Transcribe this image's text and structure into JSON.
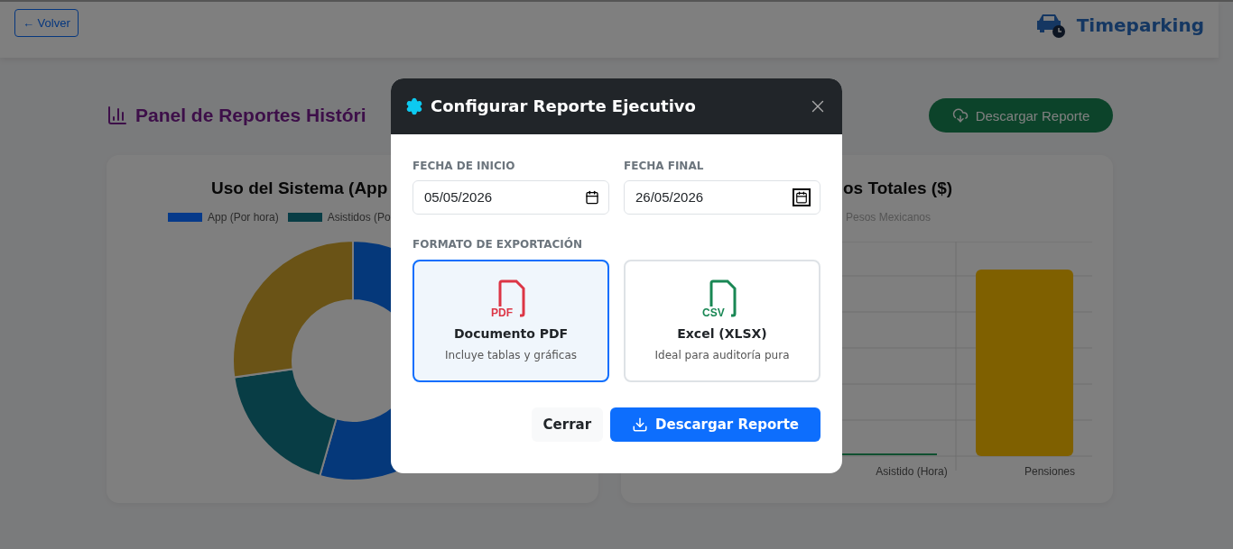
{
  "header": {
    "back_button": "← Volver",
    "brand": "Timeparking"
  },
  "page": {
    "title": "Panel de Reportes Históri",
    "download_button": "Descargar Reporte"
  },
  "usage_card": {
    "title": "Uso del Sistema (App",
    "legend": [
      {
        "label": "App (Por hora)",
        "color": "#063a8a"
      },
      {
        "label": "Asistidos (Po",
        "color": "#083d45"
      }
    ]
  },
  "revenue_card": {
    "title": "os Totales ($)",
    "legend": "Pesos Mexicanos",
    "x_labels": [
      "Asistido (Hora)",
      "Pensiones"
    ]
  },
  "modal": {
    "title": "Configurar Reporte Ejecutivo",
    "fields": [
      {
        "label": "FECHA DE INICIO",
        "value": "05/05/2026",
        "focused": false
      },
      {
        "label": "FECHA FINAL",
        "value": "26/05/2026",
        "focused": true
      }
    ],
    "format_label": "FORMATO DE EXPORTACIÓN",
    "formats": [
      {
        "badge": "PDF",
        "title": "Documento PDF",
        "subtitle": "Incluye tablas y gráficas",
        "color": "#dc3545",
        "selected": true
      },
      {
        "badge": "CSV",
        "title": "Excel (XLSX)",
        "subtitle": "Ideal para auditoría pura",
        "color": "#198754",
        "selected": false
      }
    ],
    "buttons": [
      {
        "label": "Cerrar",
        "kind": "secondary"
      },
      {
        "label": "Descargar Reporte",
        "kind": "primary"
      }
    ]
  }
}
